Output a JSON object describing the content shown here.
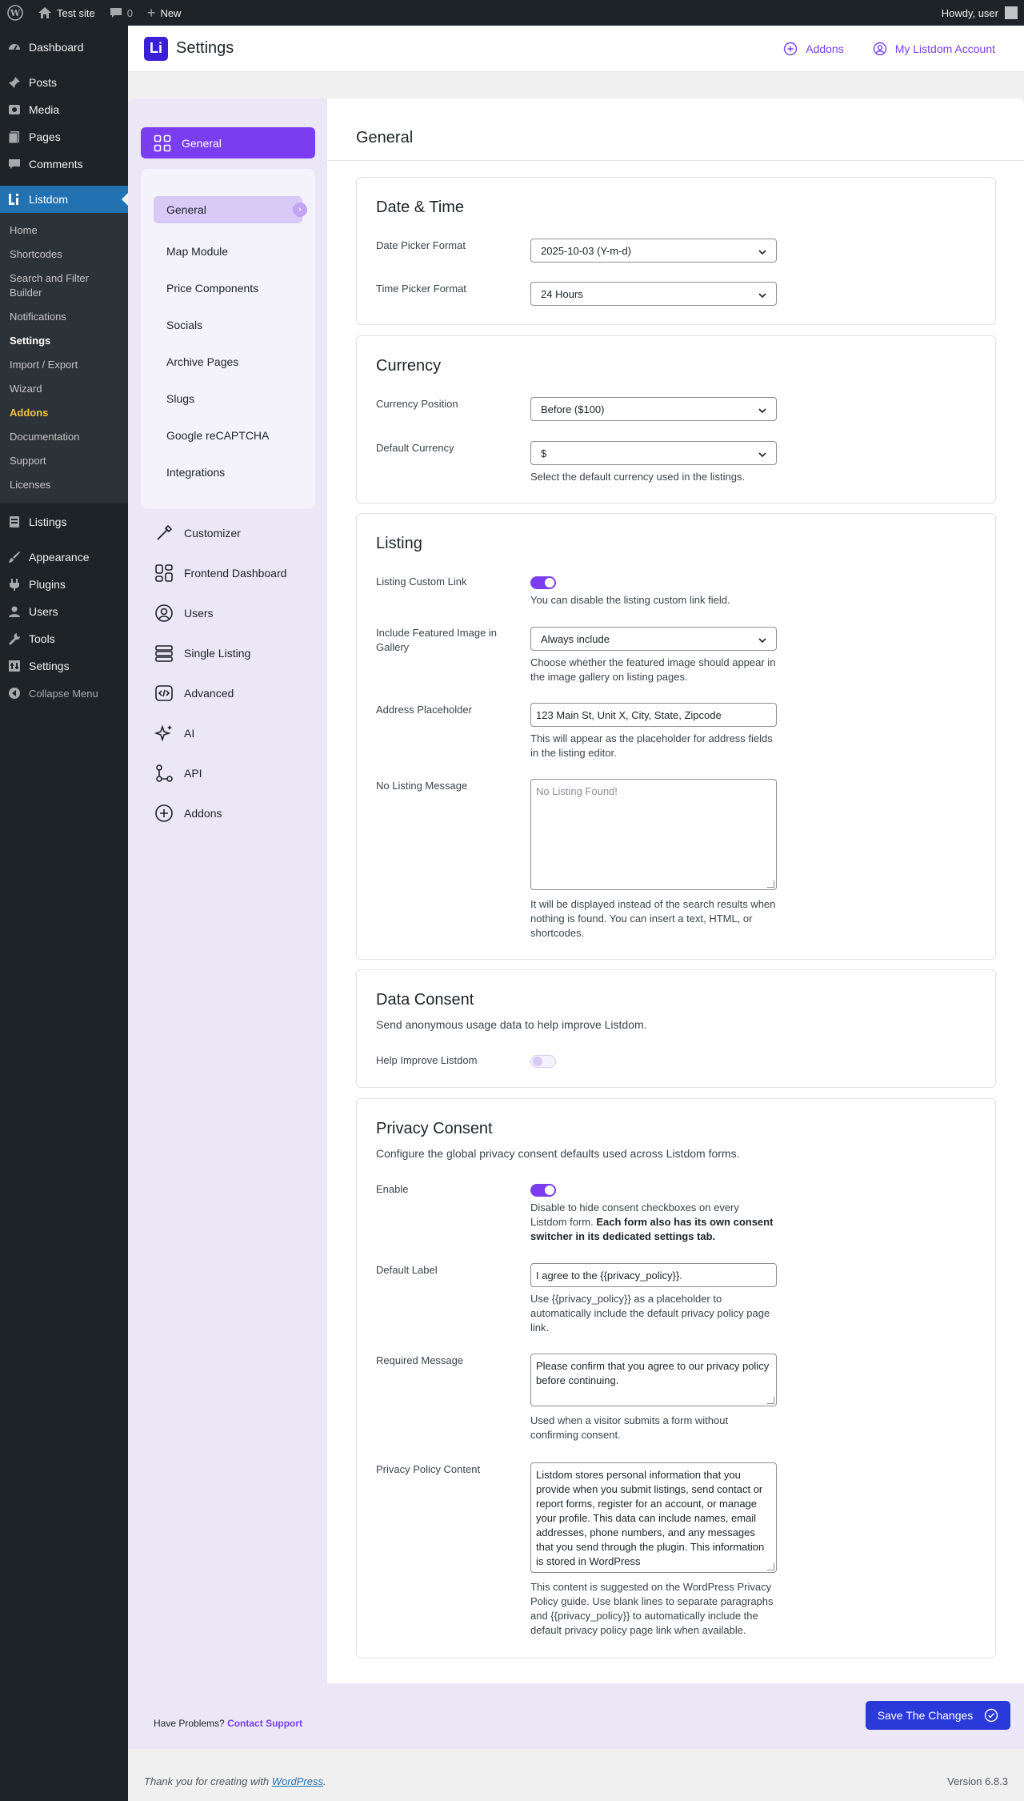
{
  "adminbar": {
    "site_name": "Test site",
    "comments_count": "0",
    "new_label": "New",
    "howdy": "Howdy, user"
  },
  "adminmenu": {
    "items_top": [
      {
        "label": "Dashboard",
        "icon": "dashboard-icon"
      },
      {
        "label": "Posts",
        "icon": "pin-icon"
      },
      {
        "label": "Media",
        "icon": "media-icon"
      },
      {
        "label": "Pages",
        "icon": "page-icon"
      },
      {
        "label": "Comments",
        "icon": "comment-icon"
      }
    ],
    "current": "Listdom",
    "submenu": [
      "Home",
      "Shortcodes",
      "Search and Filter Builder",
      "Notifications",
      "Settings",
      "Import / Export",
      "Wizard",
      "Addons",
      "Documentation",
      "Support",
      "Licenses"
    ],
    "items_bottom": [
      {
        "label": "Listings",
        "icon": "listings-icon"
      },
      {
        "label": "Appearance",
        "icon": "brush-icon"
      },
      {
        "label": "Plugins",
        "icon": "plugin-icon"
      },
      {
        "label": "Users",
        "icon": "user-icon"
      },
      {
        "label": "Tools",
        "icon": "wrench-icon"
      },
      {
        "label": "Settings",
        "icon": "settings-icon"
      }
    ],
    "collapse": "Collapse Menu"
  },
  "header": {
    "logo": "Li",
    "title": "Settings",
    "addons_link": "Addons",
    "account_link": "My Listdom Account"
  },
  "settings_nav": {
    "main": "General",
    "sub": [
      "General",
      "Map Module",
      "Price Components",
      "Socials",
      "Archive Pages",
      "Slugs",
      "Google reCAPTCHA",
      "Integrations"
    ],
    "sections": [
      "Customizer",
      "Frontend Dashboard",
      "Users",
      "Single Listing",
      "Advanced",
      "AI",
      "API",
      "Addons"
    ],
    "support_text": "Have Problems?",
    "support_link": "Contact Support"
  },
  "main": {
    "page_title": "General",
    "datetime": {
      "title": "Date & Time",
      "date_label": "Date Picker Format",
      "date_value": "2025-10-03 (Y-m-d)",
      "time_label": "Time Picker Format",
      "time_value": "24 Hours"
    },
    "currency": {
      "title": "Currency",
      "position_label": "Currency Position",
      "position_value": "Before ($100)",
      "default_label": "Default Currency",
      "default_value": "$",
      "default_help": "Select the default currency used in the listings."
    },
    "listing": {
      "title": "Listing",
      "custom_link_label": "Listing Custom Link",
      "custom_link_enabled": true,
      "custom_link_help": "You can disable the listing custom link field.",
      "featured_label": "Include Featured Image in Gallery",
      "featured_value": "Always include",
      "featured_help": "Choose whether the featured image should appear in the image gallery on listing pages.",
      "address_label": "Address Placeholder",
      "address_value": "123 Main St, Unit X, City, State, Zipcode",
      "address_help": "This will appear as the placeholder for address fields in the listing editor.",
      "nolisting_label": "No Listing Message",
      "nolisting_placeholder": "No Listing Found!",
      "nolisting_help": "It will be displayed instead of the search results when nothing is found. You can insert a text, HTML, or shortcodes."
    },
    "consent": {
      "title": "Data Consent",
      "desc": "Send anonymous usage data to help improve Listdom.",
      "help_label": "Help Improve Listdom",
      "enabled": false
    },
    "privacy": {
      "title": "Privacy Consent",
      "desc": "Configure the global privacy consent defaults used across Listdom forms.",
      "enable_label": "Enable",
      "enabled": true,
      "enable_help": "Disable to hide consent checkboxes on every Listdom form.",
      "enable_help_bold": "Each form also has its own consent switcher in its dedicated settings tab.",
      "label_label": "Default Label",
      "label_value": "I agree to the {{privacy_policy}}.",
      "label_help": "Use {{privacy_policy}} as a placeholder to automatically include the default privacy policy page link.",
      "required_label": "Required Message",
      "required_value": "Please confirm that you agree to our privacy policy before continuing.",
      "required_help": "Used when a visitor submits a form without confirming consent.",
      "policy_label": "Privacy Policy Content",
      "policy_value": "Listdom stores personal information that you provide when you submit listings, send contact or report forms, register for an account, or manage your profile. This data can include names, email addresses, phone numbers, and any messages that you send through the plugin. This information is stored in WordPress",
      "policy_help": "This content is suggested on the WordPress Privacy Policy guide. Use blank lines to separate paragraphs and {{privacy_policy}} to automatically include the default privacy policy page link when available."
    }
  },
  "save_button": "Save The Changes",
  "footer": {
    "thanks": "Thank you for creating with",
    "wp_link": "WordPress",
    "version": "Version 6.8.3"
  },
  "colors": {
    "accent": "#7a3df0",
    "save": "#2a39d9",
    "admin_bg": "#1d2327",
    "wp_blue": "#2271b1"
  }
}
